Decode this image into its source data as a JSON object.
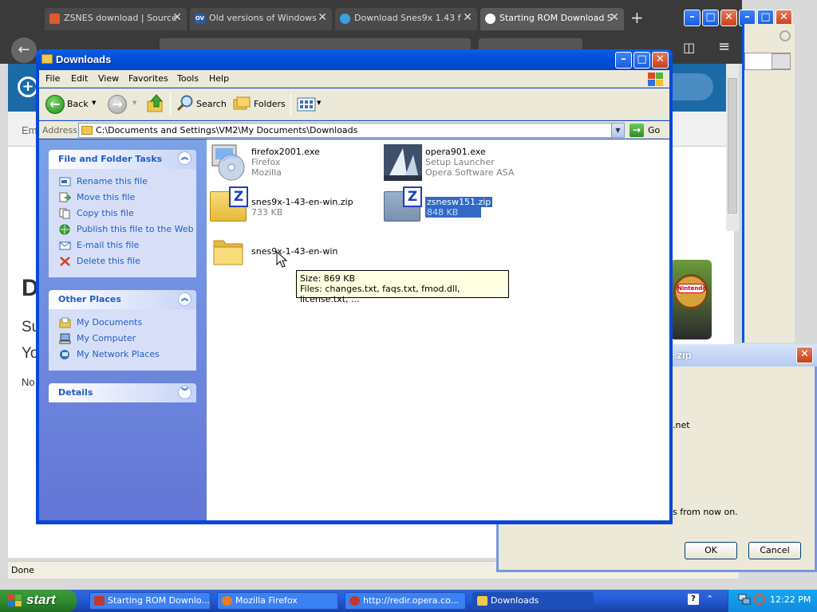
{
  "browser": {
    "tabs": [
      {
        "label": "ZSNES download | Source",
        "color": "#e05a2a"
      },
      {
        "label": "Old versions of Windows",
        "color": "#2a5aa8",
        "badge": "OV"
      },
      {
        "label": "Download Snes9x 1.43 f",
        "color": "#3aa0e0"
      },
      {
        "label": "Starting ROM Download S",
        "color": "#ffffff"
      }
    ],
    "page_text": {
      "em": "Em",
      "d": "D",
      "su": "Su",
      "yo": "Yo",
      "no": "No"
    },
    "status": "Done",
    "ad_brand": "Nintendo"
  },
  "dialog": {
    "title_fragment": ".zip",
    "net_fragment": ".net",
    "fromnow_fragment": "s from now on.",
    "ok_label": "OK",
    "cancel_label": "Cancel"
  },
  "explorer": {
    "title": "Downloads",
    "menu": [
      "File",
      "Edit",
      "View",
      "Favorites",
      "Tools",
      "Help"
    ],
    "toolbar": {
      "back": "Back",
      "search": "Search",
      "folders": "Folders"
    },
    "address": {
      "label": "Address",
      "path": "C:\\Documents and Settings\\VM2\\My Documents\\Downloads",
      "go": "Go"
    },
    "taskpane": {
      "file_tasks": {
        "title": "File and Folder Tasks",
        "items": [
          "Rename this file",
          "Move this file",
          "Copy this file",
          "Publish this file to the Web",
          "E-mail this file",
          "Delete this file"
        ]
      },
      "other_places": {
        "title": "Other Places",
        "items": [
          "My Documents",
          "My Computer",
          "My Network Places"
        ]
      },
      "details": {
        "title": "Details"
      }
    },
    "files": [
      {
        "name": "firefox2001.exe",
        "line2": "Firefox",
        "line3": "Mozilla"
      },
      {
        "name": "opera901.exe",
        "line2": "Setup Launcher",
        "line3": "Opera Software ASA"
      },
      {
        "name": "snes9x-1-43-en-win.zip",
        "line2": "733 KB"
      },
      {
        "name": "zsnesw151.zip",
        "line2": "848 KB",
        "selected": true
      },
      {
        "name": "snes9x-1-43-en-win"
      }
    ],
    "tooltip": {
      "line1": "Size: 869 KB",
      "line2": "Files: changes.txt, faqs.txt, fmod.dll, license.txt, ..."
    }
  },
  "taskbar": {
    "start": "start",
    "items": [
      {
        "label": "Starting ROM Downlo...",
        "color": "#c0392b"
      },
      {
        "label": "Mozilla Firefox",
        "color": "#e67e22"
      },
      {
        "label": "http://redir.opera.co...",
        "color": "#c0392b"
      },
      {
        "label": "Downloads",
        "color": "#f1c84b",
        "active": true
      }
    ],
    "clock": "12:22 PM"
  },
  "colors": {
    "xp_blue": "#0a46d8",
    "taskpane_link": "#215dc6",
    "selection": "#316ac5"
  }
}
